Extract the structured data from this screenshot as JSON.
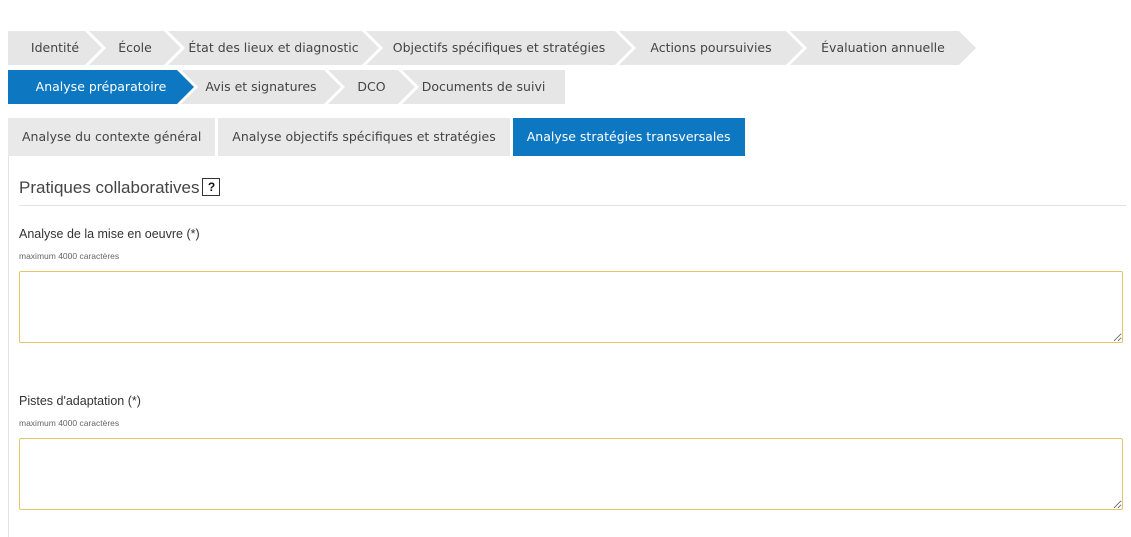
{
  "steps_row1": [
    {
      "label": "Identité",
      "active": false
    },
    {
      "label": "École",
      "active": false
    },
    {
      "label": "État des lieux et diagnostic",
      "active": false
    },
    {
      "label": "Objectifs spécifiques et stratégies",
      "active": false
    },
    {
      "label": "Actions poursuivies",
      "active": false
    },
    {
      "label": "Évaluation annuelle",
      "active": false
    }
  ],
  "steps_row2": [
    {
      "label": "Analyse préparatoire",
      "active": true
    },
    {
      "label": "Avis et signatures",
      "active": false
    },
    {
      "label": "DCO",
      "active": false
    },
    {
      "label": "Documents de suivi",
      "active": false
    }
  ],
  "subtabs": [
    {
      "label": "Analyse du contexte général",
      "active": false
    },
    {
      "label": "Analyse objectifs spécifiques et stratégies",
      "active": false
    },
    {
      "label": "Analyse stratégies transversales",
      "active": true
    }
  ],
  "section": {
    "title": "Pratiques collaboratives",
    "help_glyph": "?"
  },
  "fields": {
    "mise_en_oeuvre": {
      "label": "Analyse de la mise en oeuvre (*)",
      "hint": "maximum 4000 caractères",
      "value": ""
    },
    "pistes": {
      "label": "Pistes d'adaptation (*)",
      "hint": "maximum 4000 caractères",
      "value": ""
    }
  },
  "colors": {
    "accent": "#0d78c1",
    "inactive_step": "#e6e6e6",
    "field_border": "#e7c46c"
  }
}
